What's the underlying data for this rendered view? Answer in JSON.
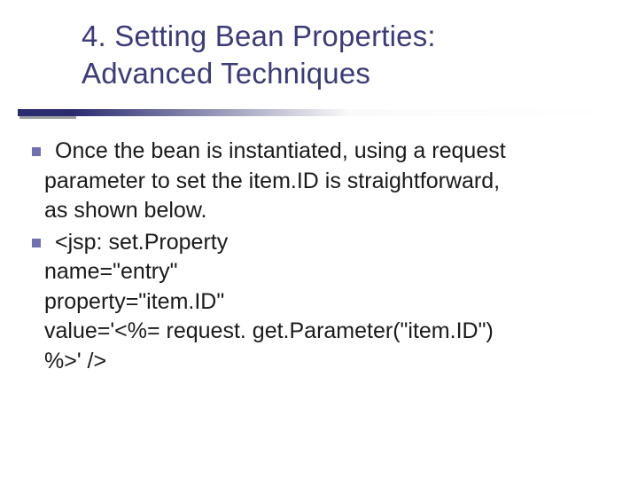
{
  "title": {
    "line1": "4. Setting Bean Properties:",
    "line2": "Advanced Techniques"
  },
  "body": {
    "item1": {
      "l1": "Once the bean is instantiated, using a request",
      "l2": "parameter to set the item.ID is straightforward,",
      "l3": "as shown below."
    },
    "item2": {
      "l1": "<jsp: set.Property",
      "l2": "name=\"entry\"",
      "l3": "property=\"item.ID\"",
      "l4": "value='<%= request. get.Parameter(\"item.ID\")",
      "l5": "%>' />"
    }
  }
}
